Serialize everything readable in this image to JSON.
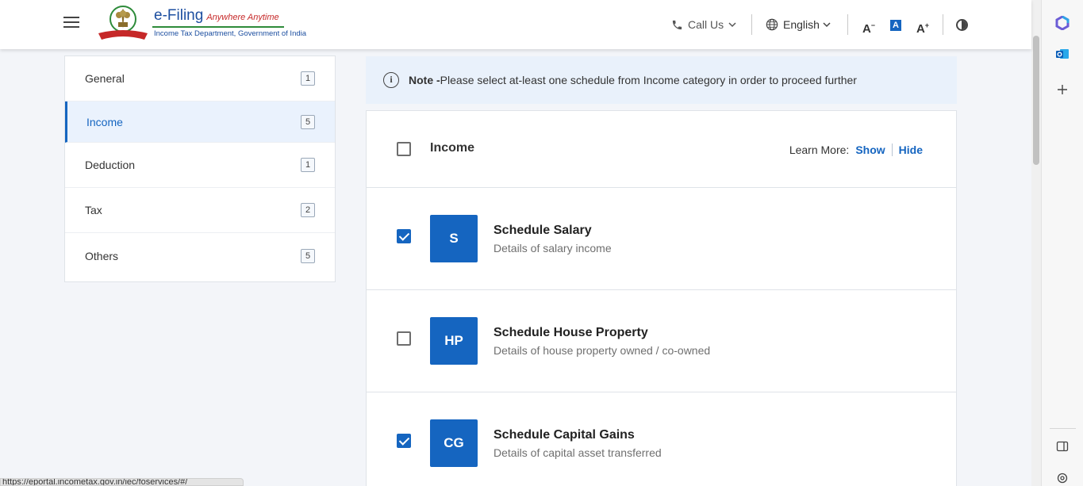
{
  "header": {
    "logo": {
      "title": "e-Filing",
      "tagline": "Anywhere Anytime",
      "department": "Income Tax Department, Government of India",
      "emblem_text": "INCOME TAX DEPARTMENT"
    },
    "call_us_label": "Call Us",
    "language_label": "English",
    "font_decrease_label": "A",
    "font_default_label": "A",
    "font_increase_label": "A",
    "icons": [
      "menu-icon",
      "phone-icon",
      "globe-icon",
      "chevron-down-icon",
      "contrast-icon"
    ]
  },
  "nav": {
    "items": [
      {
        "label": "General",
        "count": "1"
      },
      {
        "label": "Income",
        "count": "5",
        "active": true
      },
      {
        "label": "Deduction",
        "count": "1"
      },
      {
        "label": "Tax",
        "count": "2"
      },
      {
        "label": "Others",
        "count": "5"
      }
    ]
  },
  "note": {
    "prefix": "Note -",
    "text": "Please select at-least one schedule from Income category in order to proceed further"
  },
  "panel": {
    "title": "Income",
    "learn_more_label": "Learn More:",
    "show_label": "Show",
    "hide_label": "Hide",
    "schedules": [
      {
        "code": "S",
        "title": "Schedule Salary",
        "subtitle": "Details of salary income",
        "checked": true
      },
      {
        "code": "HP",
        "title": "Schedule House Property",
        "subtitle": "Details of house property owned / co-owned",
        "checked": false
      },
      {
        "code": "CG",
        "title": "Schedule Capital Gains",
        "subtitle": "Details of capital asset transferred",
        "checked": true
      }
    ]
  },
  "statusbar": {
    "url": "https://eportal.incometax.gov.in/iec/foservices/#/"
  },
  "colors": {
    "accent": "#1565c0",
    "active_nav_bg": "#eaf2fd",
    "note_bg": "#e9f1fb"
  }
}
